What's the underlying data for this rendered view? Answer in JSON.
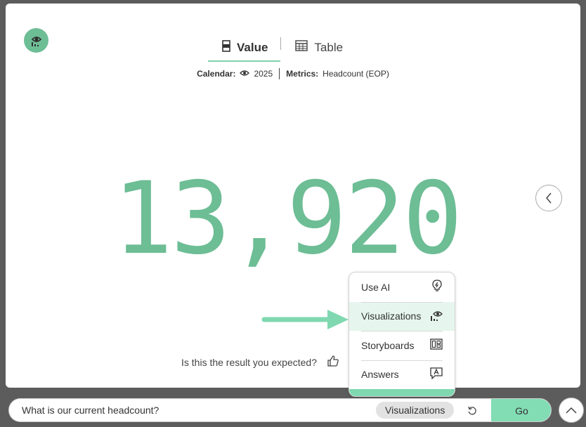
{
  "tabs": [
    {
      "label": "Value",
      "icon": "value-icon",
      "active": true
    },
    {
      "label": "Table",
      "icon": "table-icon",
      "active": false
    }
  ],
  "filters": {
    "calendar_key": "Calendar:",
    "calendar_value": "2025",
    "metrics_key": "Metrics:",
    "metrics_value": "Headcount (EOP)"
  },
  "result": {
    "value": "13,920"
  },
  "feedback": {
    "question": "Is this the result you expected?"
  },
  "menu": {
    "items": [
      {
        "label": "Use AI",
        "icon": "lightbulb-icon"
      },
      {
        "label": "Visualizations",
        "icon": "visualization-icon",
        "selected": true
      },
      {
        "label": "Storyboards",
        "icon": "storyboard-icon"
      },
      {
        "label": "Answers",
        "icon": "answers-icon"
      }
    ]
  },
  "search": {
    "value": "What is our current headcount?",
    "mode_chip": "Visualizations",
    "go_label": "Go"
  },
  "colors": {
    "accent": "#6dbd95",
    "accent_light": "#82dcb4",
    "selected_bg": "#e6f6ee",
    "overlay": "#5c5c5c"
  }
}
